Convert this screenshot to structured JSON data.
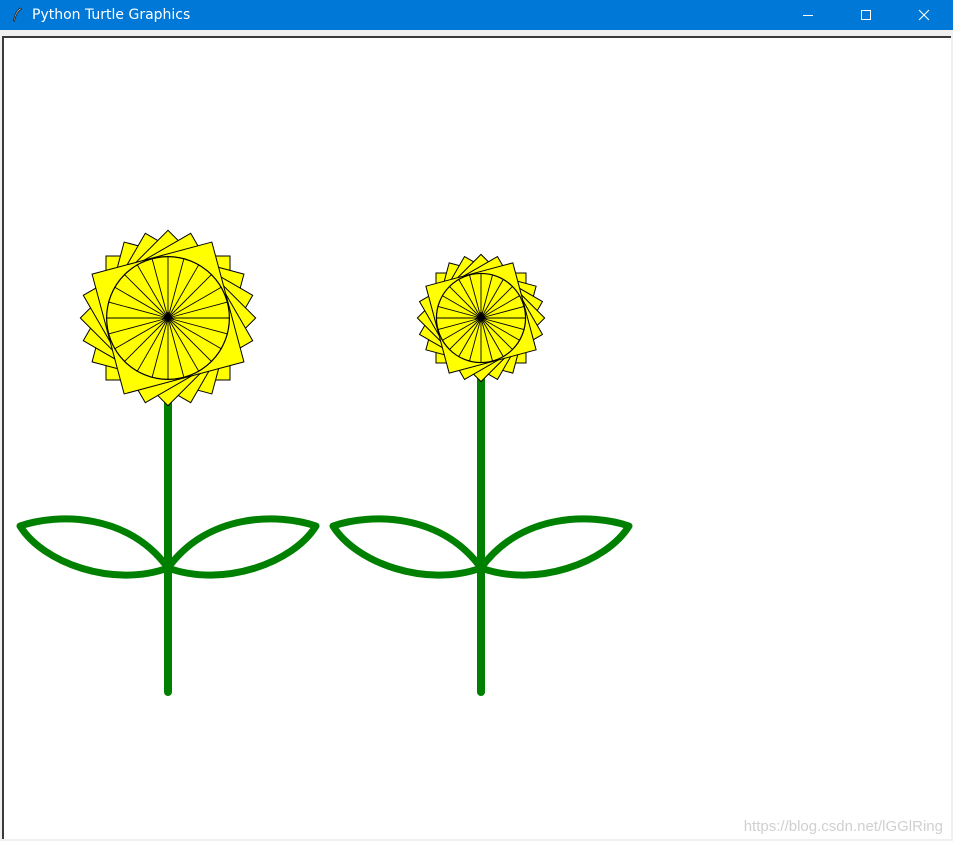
{
  "window": {
    "title": "Python Turtle Graphics",
    "app_icon": "feather-pen-icon",
    "controls": [
      "minimize-icon",
      "maximize-icon",
      "close-icon"
    ]
  },
  "canvas": {
    "background": "#ffffff",
    "watermark": "https://blog.csdn.net/lGGlRing"
  },
  "flowers": [
    {
      "petal_color": "#ffff00",
      "stem_color": "#008000",
      "outline_color": "#000000",
      "size": "large"
    },
    {
      "petal_color": "#ffff00",
      "stem_color": "#008000",
      "outline_color": "#000000",
      "size": "small"
    }
  ],
  "colors": {
    "titlebar": "#0078d7",
    "titlebar_text": "#ffffff"
  }
}
